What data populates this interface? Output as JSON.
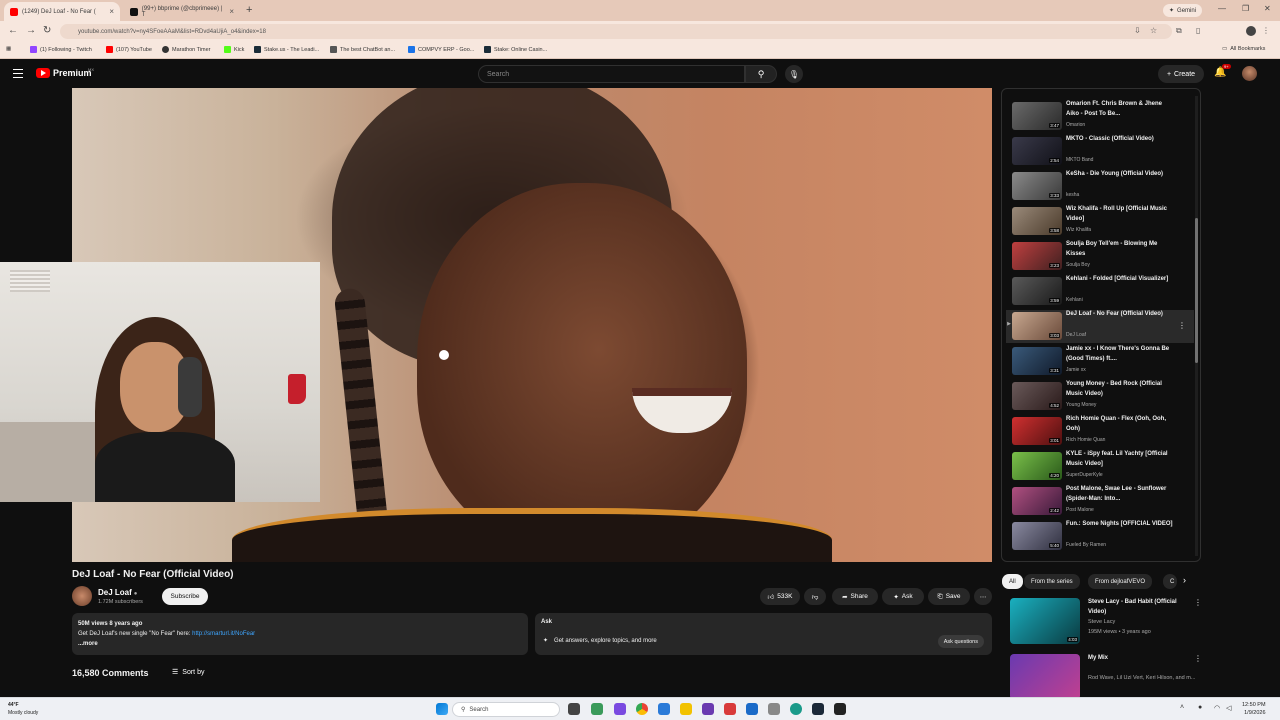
{
  "browser": {
    "tabs": [
      {
        "label": "(1249) DeJ Loaf - No Fear (",
        "active": true
      },
      {
        "label": "(99+) bbprime (@cbprimeee) | T",
        "active": false
      }
    ],
    "new_tab": "+",
    "gemini": "Gemini",
    "url": "youtube.com/watch?v=ny4SFoeAAaM&list=RDvd4aUjiA_o4&index=18",
    "bookmarks": [
      "(1) Following - Twitch",
      "(107) YouTube",
      "Marathon Timer",
      "Kick",
      "Stake.us - The Leadi...",
      "The best ChatBot an...",
      "COMPVY ERP - Goo...",
      "Stake: Online Casin..."
    ],
    "all_bookmarks": "All Bookmarks"
  },
  "youtube": {
    "brand": "Premium",
    "region": "MX",
    "search_placeholder": "Search",
    "create": "Create",
    "notif_badge": "9+"
  },
  "video": {
    "title": "DeJ Loaf - No Fear (Official Video)",
    "channel": "DeJ Loaf",
    "subscribers": "1.72M subscribers",
    "subscribe": "Subscribe",
    "likes": "533K",
    "share": "Share",
    "ask": "Ask",
    "save": "Save",
    "views_date": "50M views  8 years ago",
    "description": "Get DeJ Loaf's new single \"No Fear\" here: ",
    "description_link": "http://smarturl.it/NoFear",
    "more": "...more",
    "ask_title": "Ask",
    "ask_prompt": "Get answers, explore topics, and more",
    "ask_questions": "Ask questions",
    "comments_count": "16,580 Comments",
    "sort_by": "Sort by"
  },
  "playlist": [
    {
      "title": "Omarion Ft. Chris Brown & Jhene Aiko - Post To Be...",
      "channel": "Omarion",
      "duration": "3:47",
      "colors": [
        "#6a6a6a",
        "#2a2a2a"
      ]
    },
    {
      "title": "MKTO - Classic (Official Video)",
      "channel": "MKTO Band",
      "duration": "2:54",
      "colors": [
        "#3a3a4a",
        "#111118"
      ]
    },
    {
      "title": "KeSha - Die Young (Official Video)",
      "channel": "kesha",
      "duration": "3:33",
      "colors": [
        "#8a8a8a",
        "#3a3a3a"
      ]
    },
    {
      "title": "Wiz Khalifa - Roll Up [Official Music Video]",
      "channel": "Wiz Khalifa",
      "duration": "3:58",
      "colors": [
        "#9a8a7a",
        "#4a3a2a"
      ]
    },
    {
      "title": "Soulja Boy Tell'em - Blowing Me Kisses",
      "channel": "Soulja Boy",
      "duration": "3:23",
      "colors": [
        "#c04040",
        "#402020"
      ]
    },
    {
      "title": "Kehlani - Folded [Official Visualizer]",
      "channel": "Kehlani",
      "duration": "3:59",
      "colors": [
        "#5a5a5a",
        "#1a1a1a"
      ]
    },
    {
      "title": "DeJ Loaf - No Fear (Official Video)",
      "channel": "DeJ Loaf",
      "duration": "3:03",
      "colors": [
        "#c8a890",
        "#6a4a3a"
      ],
      "active": true
    },
    {
      "title": "Jamie xx - I Know There's Gonna Be (Good Times) ft....",
      "channel": "Jamie xx",
      "duration": "3:31",
      "colors": [
        "#3a5a7a",
        "#101a2a"
      ]
    },
    {
      "title": "Young Money - Bed Rock (Official Music Video)",
      "channel": "Young Money",
      "duration": "4:52",
      "colors": [
        "#6a5a5a",
        "#2a1a1a"
      ]
    },
    {
      "title": "Rich Homie Quan - Flex (Ooh, Ooh, Ooh)",
      "channel": "Rich Homie Quan",
      "duration": "3:01",
      "colors": [
        "#d03030",
        "#501010"
      ]
    },
    {
      "title": "KYLE - iSpy feat. Lil Yachty [Official Music Video]",
      "channel": "SuperDuperKyle",
      "duration": "4:20",
      "colors": [
        "#7ac04a",
        "#2a5a1a"
      ]
    },
    {
      "title": "Post Malone, Swae Lee - Sunflower (Spider-Man: Into...",
      "channel": "Post Malone",
      "duration": "2:42",
      "colors": [
        "#b05080",
        "#3a1a3a"
      ]
    },
    {
      "title": "Fun.: Some Nights [OFFICIAL VIDEO]",
      "channel": "Fueled By Ramen",
      "duration": "5:40",
      "colors": [
        "#8a8aa0",
        "#303040"
      ]
    }
  ],
  "chips": [
    "All",
    "From the series",
    "From dejloafVEVO",
    "C"
  ],
  "recommended": [
    {
      "title": "Steve Lacy - Bad Habit (Official Video)",
      "channel": "Steve Lacy",
      "meta": "195M views • 3 years ago",
      "duration": "4:03",
      "colors": [
        "#1ab0c0",
        "#0a3a40"
      ]
    },
    {
      "title": "My Mix",
      "channel": "Rod Wave, Lil Uzi Vert, Keri Hilson, and m...",
      "meta": "",
      "duration": "",
      "colors": [
        "#6a3ab0",
        "#c04090"
      ]
    }
  ],
  "taskbar": {
    "weather_temp": "44°F",
    "weather_desc": "Mostly cloudy",
    "search": "Search",
    "time": "12:50 PM",
    "date": "1/9/2026"
  }
}
